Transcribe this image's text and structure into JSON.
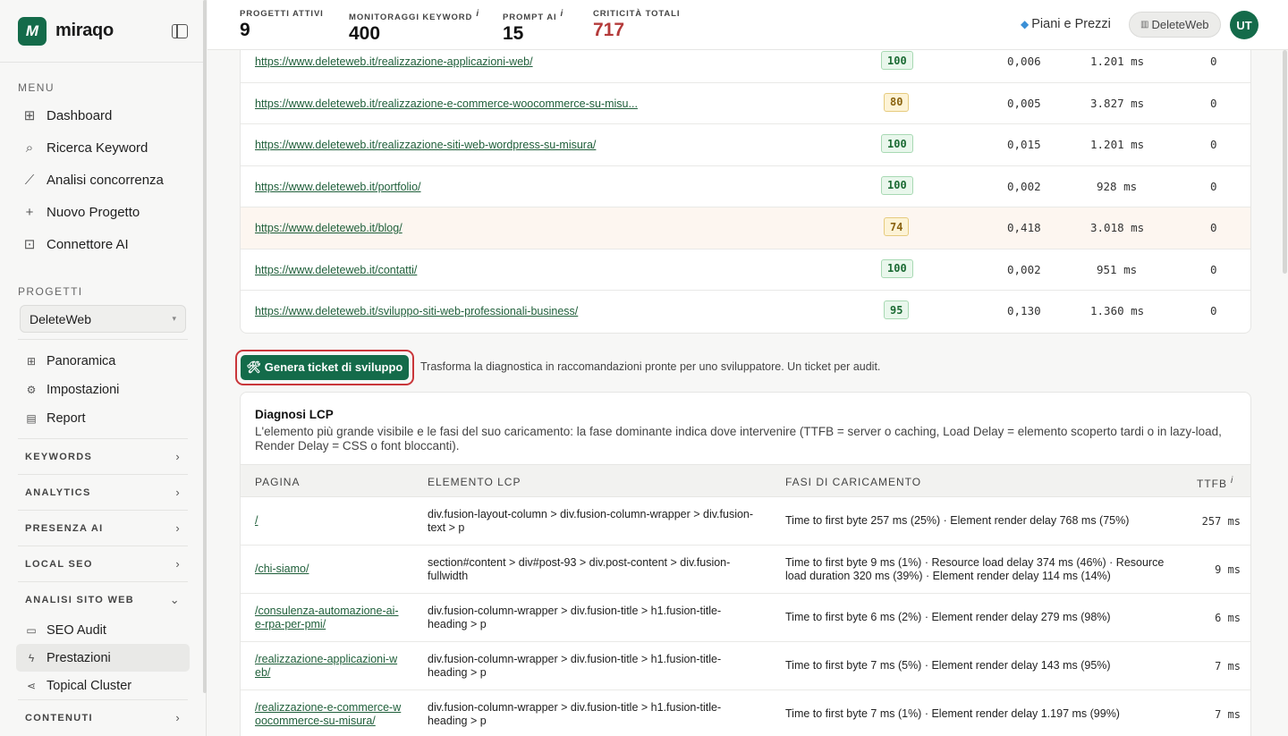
{
  "brand": {
    "logo_letter": "M",
    "name": "miraqo"
  },
  "sidebar": {
    "menu_label": "MENU",
    "menu_items": [
      {
        "icon": "grid-icon",
        "label": "Dashboard"
      },
      {
        "icon": "search-icon",
        "label": "Ricerca Keyword"
      },
      {
        "icon": "chart-line-icon",
        "label": "Analisi concorrenza"
      },
      {
        "icon": "plus-icon",
        "label": "Nuovo Progetto"
      },
      {
        "icon": "robot-icon",
        "label": "Connettore AI"
      }
    ],
    "projects_label": "PROGETTI",
    "selected_project": "DeleteWeb",
    "project_items": [
      {
        "icon": "grid-icon",
        "label": "Panoramica"
      },
      {
        "icon": "gear-icon",
        "label": "Impostazioni"
      },
      {
        "icon": "document-icon",
        "label": "Report"
      }
    ],
    "groups": [
      {
        "label": "KEYWORDS"
      },
      {
        "label": "ANALYTICS"
      },
      {
        "label": "PRESENZA AI"
      },
      {
        "label": "LOCAL SEO"
      }
    ],
    "open_group": {
      "label": "ANALISI SITO WEB",
      "items": [
        {
          "icon": "monitor-icon",
          "label": "SEO Audit"
        },
        {
          "icon": "bolt-icon",
          "label": "Prestazioni",
          "active": true
        },
        {
          "icon": "share-icon",
          "label": "Topical Cluster"
        }
      ]
    },
    "last_group": {
      "label": "CONTENUTI"
    }
  },
  "topbar": {
    "stats": [
      {
        "label": "PROGETTI ATTIVI",
        "value": "9",
        "info": ""
      },
      {
        "label": "MONITORAGGI KEYWORD",
        "value": "400",
        "info": "i"
      },
      {
        "label": "PROMPT AI",
        "value": "15",
        "info": "i"
      },
      {
        "label": "CRITICITÀ TOTALI",
        "value": "717",
        "info": ""
      }
    ],
    "pricing_label": "Piani e Prezzi",
    "project_chip": "DeleteWeb",
    "avatar_initials": "UT"
  },
  "perf_rows": [
    {
      "url": "https://www.deleteweb.it/realizzazione-applicazioni-web/",
      "score": "100",
      "status": "good",
      "cls": "0,006",
      "time": "1.201 ms",
      "n": "0"
    },
    {
      "url": "https://www.deleteweb.it/realizzazione-e-commerce-woocommerce-su-misu...",
      "score": "80",
      "status": "mid",
      "cls": "0,005",
      "time": "3.827 ms",
      "n": "0"
    },
    {
      "url": "https://www.deleteweb.it/realizzazione-siti-web-wordpress-su-misura/",
      "score": "100",
      "status": "good",
      "cls": "0,015",
      "time": "1.201 ms",
      "n": "0"
    },
    {
      "url": "https://www.deleteweb.it/portfolio/",
      "score": "100",
      "status": "good",
      "cls": "0,002",
      "time": "928 ms",
      "n": "0"
    },
    {
      "url": "https://www.deleteweb.it/blog/",
      "score": "74",
      "status": "mid",
      "cls": "0,418",
      "time": "3.018 ms",
      "n": "0",
      "highlight": true
    },
    {
      "url": "https://www.deleteweb.it/contatti/",
      "score": "100",
      "status": "good",
      "cls": "0,002",
      "time": "951 ms",
      "n": "0"
    },
    {
      "url": "https://www.deleteweb.it/sviluppo-siti-web-professionali-business/",
      "score": "95",
      "status": "good",
      "cls": "0,130",
      "time": "1.360 ms",
      "n": "0"
    }
  ],
  "ticket": {
    "button_label": "🛠 Genera ticket di sviluppo",
    "description": "Trasforma la diagnostica in raccomandazioni pronte per uno sviluppatore. Un ticket per audit."
  },
  "lcp": {
    "title": "Diagnosi LCP",
    "description": "L'elemento più grande visibile e le fasi del suo caricamento: la fase dominante indica dove intervenire (TTFB = server o caching, Load Delay = elemento scoperto tardi o in lazy-load, Render Delay = CSS o font bloccanti).",
    "columns": {
      "page": "PAGINA",
      "element": "ELEMENTO LCP",
      "phases": "FASI DI CARICAMENTO",
      "ttfb": "TTFB",
      "ttfb_info": "i"
    },
    "rows": [
      {
        "page": "/",
        "element": "div.fusion-layout-column > div.fusion-column-wrapper > div.fusion-text > p",
        "phases": "Time to first byte 257 ms (25%) · Element render delay 768 ms (75%)",
        "ttfb": "257 ms"
      },
      {
        "page": "/chi-siamo/",
        "element": "section#content > div#post-93 > div.post-content > div.fusion-fullwidth",
        "phases": "Time to first byte 9 ms (1%) · Resource load delay 374 ms (46%) · Resource load duration 320 ms (39%) · Element render delay 114 ms (14%)",
        "ttfb": "9 ms"
      },
      {
        "page": "/consulenza-automazione-ai-e-rpa-per-pmi/",
        "element": "div.fusion-column-wrapper > div.fusion-title > h1.fusion-title-heading > p",
        "phases": "Time to first byte 6 ms (2%) · Element render delay 279 ms (98%)",
        "ttfb": "6 ms"
      },
      {
        "page": "/realizzazione-applicazioni-web/",
        "element": "div.fusion-column-wrapper > div.fusion-title > h1.fusion-title-heading > p",
        "phases": "Time to first byte 7 ms (5%) · Element render delay 143 ms (95%)",
        "ttfb": "7 ms"
      },
      {
        "page": "/realizzazione-e-commerce-woocommerce-su-misura/",
        "element": "div.fusion-column-wrapper > div.fusion-title > h1.fusion-title-heading > p",
        "phases": "Time to first byte 7 ms (1%) · Element render delay 1.197 ms (99%)",
        "ttfb": "7 ms"
      }
    ]
  },
  "colors": {
    "brand_green": "#146b4a",
    "critical_red": "#b43a3a",
    "highlight_red": "#c9363a"
  }
}
